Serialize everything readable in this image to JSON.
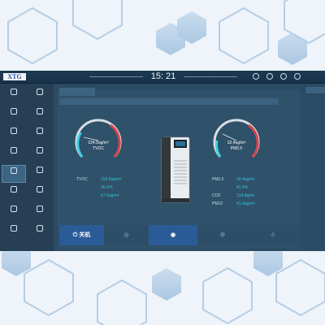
{
  "header": {
    "logo_text": "XTG",
    "app_title": "",
    "clock": "15: 21",
    "user": ""
  },
  "sidebar": {
    "items": [
      {
        "label": ""
      },
      {
        "label": ""
      },
      {
        "label": ""
      },
      {
        "label": ""
      },
      {
        "label": ""
      },
      {
        "label": ""
      },
      {
        "label": ""
      },
      {
        "label": ""
      },
      {
        "label": ""
      },
      {
        "label": ""
      },
      {
        "label": ""
      },
      {
        "label": ""
      },
      {
        "label": ""
      },
      {
        "label": ""
      },
      {
        "label": ""
      },
      {
        "label": ""
      }
    ],
    "active_index": 8
  },
  "main": {
    "tab_label": "",
    "panel_title": "",
    "right_peek": ""
  },
  "gauge_left": {
    "value": "224.0ug/m³",
    "name": "TVOC",
    "status": "",
    "fraction": 0.55
  },
  "gauge_right": {
    "value": "32.4ug/m³",
    "name": "PM2.5",
    "status": "",
    "fraction": 0.5
  },
  "readings_left": [
    {
      "key": "TVOC",
      "value": "224.0ug/m³"
    },
    {
      "key": "",
      "value": "26.0℃"
    },
    {
      "key": "",
      "value": "67.0ug/m³"
    }
  ],
  "readings_right": [
    {
      "key": "PM2.5",
      "value": "32.4ug/m³"
    },
    {
      "key": "",
      "value": "41.4%"
    },
    {
      "key": "CO2",
      "value": "134.8ppm"
    },
    {
      "key": "PM10",
      "value": "41.0ug/m³"
    }
  ],
  "fan": {
    "label": "",
    "button_label": ""
  },
  "modes": [
    {
      "label": "关机",
      "active": true
    },
    {
      "label": "",
      "active": false
    },
    {
      "label": "",
      "active": true
    },
    {
      "label": "",
      "active": false
    },
    {
      "label": "",
      "active": false
    }
  ],
  "colors": {
    "accent_cyan": "#3fd0e6",
    "gauge_red": "#d9444c",
    "active_button": "#2a5b96"
  }
}
